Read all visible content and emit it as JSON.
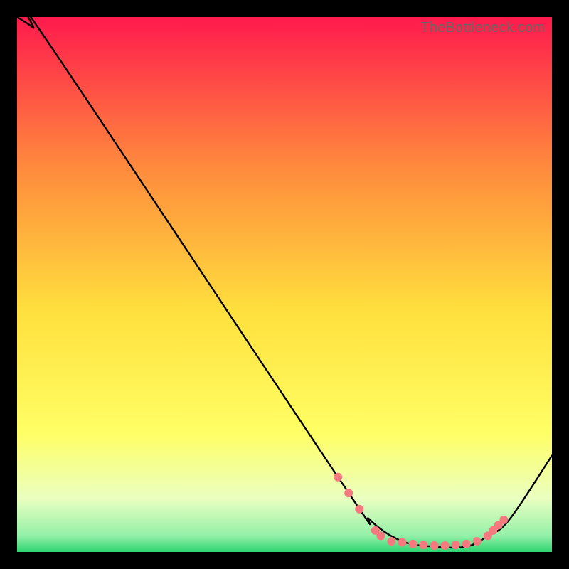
{
  "watermark": "TheBottleneck.com",
  "chart_data": {
    "type": "line",
    "title": "",
    "xlabel": "",
    "ylabel": "",
    "xlim": [
      0,
      100
    ],
    "ylim": [
      0,
      100
    ],
    "grid": false,
    "legend": false,
    "background_gradient": {
      "top": "#ff1a4d",
      "mid1": "#ff8a3d",
      "mid2": "#ffe03d",
      "mid3": "#ffff66",
      "mid4": "#eaffc0",
      "bottom": "#2dd36f"
    },
    "series": [
      {
        "name": "bottleneck-curve",
        "x": [
          0,
          3,
          6,
          60,
          66,
          72,
          78,
          84,
          88,
          92,
          100
        ],
        "y": [
          100,
          98,
          95,
          14,
          6,
          2,
          1,
          1,
          3,
          6,
          18
        ]
      }
    ],
    "markers": [
      {
        "x": 60,
        "y": 14
      },
      {
        "x": 62,
        "y": 11
      },
      {
        "x": 64,
        "y": 8
      },
      {
        "x": 67,
        "y": 4
      },
      {
        "x": 68,
        "y": 3
      },
      {
        "x": 70,
        "y": 2
      },
      {
        "x": 72,
        "y": 1.8
      },
      {
        "x": 74,
        "y": 1.5
      },
      {
        "x": 76,
        "y": 1.3
      },
      {
        "x": 78,
        "y": 1.2
      },
      {
        "x": 80,
        "y": 1.2
      },
      {
        "x": 82,
        "y": 1.3
      },
      {
        "x": 84,
        "y": 1.5
      },
      {
        "x": 86,
        "y": 2
      },
      {
        "x": 88,
        "y": 3
      },
      {
        "x": 89,
        "y": 4
      },
      {
        "x": 90,
        "y": 5
      },
      {
        "x": 91,
        "y": 6
      }
    ],
    "marker_color": "#f47a7f"
  }
}
